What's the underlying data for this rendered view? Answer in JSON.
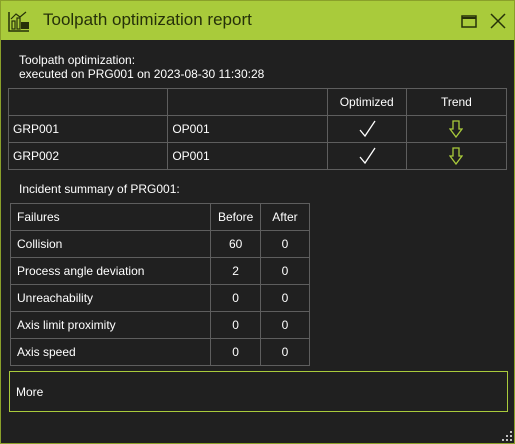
{
  "window": {
    "title": "Toolpath optimization report",
    "accent_color": "#a9cb3b",
    "icons": [
      "report-icon",
      "restore-icon",
      "close-icon"
    ]
  },
  "report": {
    "line1": "Toolpath optimization:",
    "line2": "executed on PRG001 on 2023-08-30 11:30:28"
  },
  "summary_table": {
    "columns": [
      "",
      "",
      "Optimized",
      "Trend"
    ],
    "rows": [
      {
        "group": "GRP001",
        "operation": "OP001",
        "optimized": "checkmark-icon",
        "trend": "arrow-down-icon"
      },
      {
        "group": "GRP002",
        "operation": "OP001",
        "optimized": "checkmark-icon",
        "trend": "arrow-down-icon"
      }
    ]
  },
  "incident": {
    "title": "Incident summary of PRG001:",
    "headers": [
      "Failures",
      "Before",
      "After"
    ],
    "rows": [
      {
        "label": "Collision",
        "before": "60",
        "after": "0"
      },
      {
        "label": "Process angle deviation",
        "before": "2",
        "after": "0"
      },
      {
        "label": "Unreachability",
        "before": "0",
        "after": "0"
      },
      {
        "label": "Axis limit proximity",
        "before": "0",
        "after": "0"
      },
      {
        "label": "Axis speed",
        "before": "0",
        "after": "0"
      }
    ]
  },
  "more": {
    "label": "More"
  }
}
